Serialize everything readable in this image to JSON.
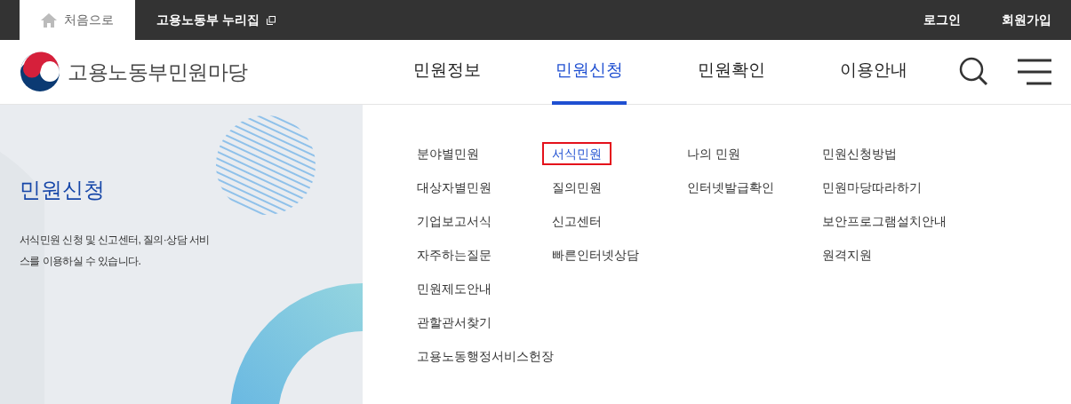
{
  "top_bar": {
    "links": [
      {
        "label": "처음으로",
        "kind": "home",
        "selected": true
      },
      {
        "label": "고용노동부 누리집",
        "kind": "external",
        "selected": false
      }
    ],
    "account": [
      "로그인",
      "회원가입"
    ]
  },
  "header": {
    "logo_text": "고용노동부민원마당",
    "nav": [
      {
        "label": "민원정보",
        "selected": false
      },
      {
        "label": "민원신청",
        "selected": true
      },
      {
        "label": "민원확인",
        "selected": false
      },
      {
        "label": "이용안내",
        "selected": false
      }
    ]
  },
  "side": {
    "title": "민원신청",
    "description": "서식민원 신청 및 신고센터, 질의·상담 서비스를 이용하실 수 있습니다."
  },
  "menu_columns": [
    [
      {
        "label": "분야별민원",
        "selected": false
      },
      {
        "label": "대상자별민원",
        "selected": false
      },
      {
        "label": "기업보고서식",
        "selected": false
      },
      {
        "label": "자주하는질문",
        "selected": false
      },
      {
        "label": "민원제도안내",
        "selected": false
      },
      {
        "label": "관할관서찾기",
        "selected": false
      },
      {
        "label": "고용노동행정서비스헌장",
        "selected": false
      }
    ],
    [
      {
        "label": "서식민원",
        "selected": true
      },
      {
        "label": "질의민원",
        "selected": false
      },
      {
        "label": "신고센터",
        "selected": false
      },
      {
        "label": "빠른인터넷상담",
        "selected": false
      }
    ],
    [
      {
        "label": "나의 민원",
        "selected": false
      },
      {
        "label": "인터넷발급확인",
        "selected": false
      }
    ],
    [
      {
        "label": "민원신청방법",
        "selected": false
      },
      {
        "label": "민원마당따라하기",
        "selected": false
      },
      {
        "label": "보안프로그램설치안내",
        "selected": false
      },
      {
        "label": "원격지원",
        "selected": false
      }
    ]
  ]
}
